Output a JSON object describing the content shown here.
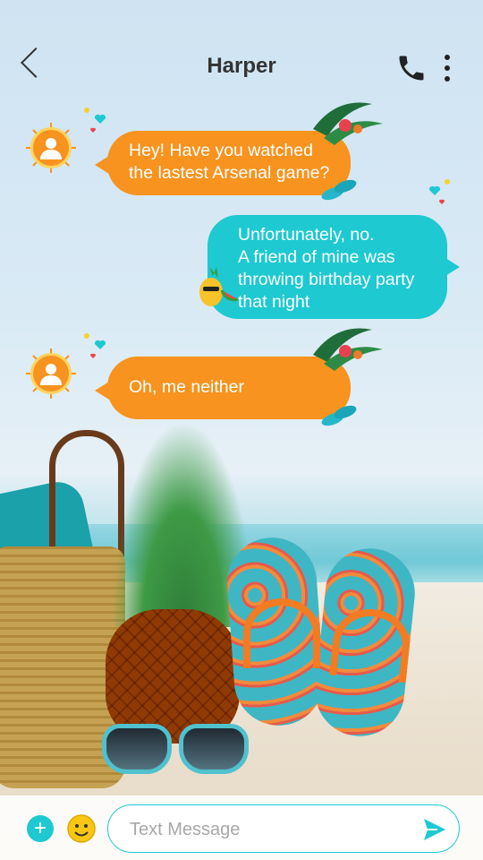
{
  "header": {
    "title": "Harper",
    "icons": {
      "back": "chevron-left-icon",
      "call": "phone-icon",
      "more": "more-vertical-icon"
    }
  },
  "messages": [
    {
      "side": "incoming",
      "text": [
        "Hey! Have you watched",
        "the lastest Arsenal game?"
      ]
    },
    {
      "side": "outgoing",
      "text": [
        "Unfortunately, no.",
        "A friend of mine was",
        "throwing birthday party",
        "that night"
      ]
    },
    {
      "side": "incoming",
      "text": [
        "Oh, me neither"
      ]
    }
  ],
  "composer": {
    "placeholder": "Text Message",
    "icons": {
      "add": "plus-icon",
      "emoji": "smiley-icon",
      "send": "send-icon"
    }
  },
  "colors": {
    "incoming_bubble": "#f7931e",
    "outgoing_bubble": "#1ec9d1",
    "text_dark": "#333333"
  }
}
